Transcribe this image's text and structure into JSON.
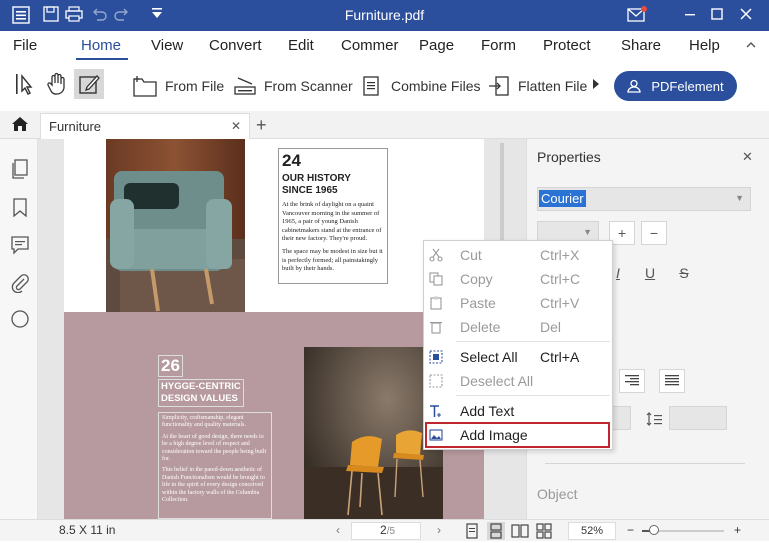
{
  "titlebar": {
    "title": "Furniture.pdf",
    "bg_color": "#2b4f9c",
    "icons": [
      "menu-icon",
      "save-icon",
      "print-icon",
      "undo-icon",
      "redo-icon",
      "quick-access-dropdown-icon",
      "mail-icon",
      "minimize-icon",
      "maximize-icon",
      "close-icon"
    ]
  },
  "menubar": {
    "items": [
      "File",
      "Home",
      "View",
      "Convert",
      "Edit",
      "Commer",
      "Page",
      "Form",
      "Protect",
      "Share",
      "Help"
    ],
    "active": "Home"
  },
  "toolbar": {
    "from_file": "From File",
    "from_scanner": "From Scanner",
    "combine_files": "Combine Files",
    "flatten_file": "Flatten File",
    "pdfelement_button": "PDFelement"
  },
  "tabs": {
    "items": [
      {
        "label": "Furniture"
      }
    ],
    "close_glyph": "✕",
    "add_glyph": "+"
  },
  "document": {
    "history": {
      "number": "24",
      "heading_line1": "OUR HISTORY",
      "heading_line2": "SINCE 1965",
      "paragraph1": "At the brink of daylight on a quaint Vancouver morning in the summer of 1965, a pair of young Danish cabinetmakers stand at the entrance of their new factory. They're proud.",
      "paragraph2": "The space may be modest in size but it is perfectly formed; all painstakingly built by their hands."
    },
    "hygge": {
      "number": "26",
      "heading_line1": "HYGGE-CENTRIC",
      "heading_line2": "DESIGN VALUES",
      "paragraph1": "Simplicity, craftsmanship, elegant functionality and quality materials.",
      "paragraph2": "At the heart of good design, there needs to be a high degree level of respect and consideration toward the people being built for.",
      "paragraph3": "This belief in the pared-down aesthetic of Danish Functionalism would be brought to life in the spirit of every design conceived within the factory walls of the Columbia Collection."
    },
    "pink_color": "#b79a9f"
  },
  "context_menu": {
    "items": [
      {
        "label": "Cut",
        "shortcut": "Ctrl+X",
        "disabled": true,
        "icon": "scissors-icon"
      },
      {
        "label": "Copy",
        "shortcut": "Ctrl+C",
        "disabled": true,
        "icon": "copy-icon"
      },
      {
        "label": "Paste",
        "shortcut": "Ctrl+V",
        "disabled": true,
        "icon": "paste-icon"
      },
      {
        "label": "Delete",
        "shortcut": "Del",
        "disabled": true,
        "icon": "trash-icon"
      },
      {
        "label": "Select All",
        "shortcut": "Ctrl+A",
        "disabled": false,
        "icon": "select-all-icon"
      },
      {
        "label": "Deselect All",
        "shortcut": "",
        "disabled": true,
        "icon": "deselect-all-icon"
      },
      {
        "label": "Add Text",
        "shortcut": "",
        "disabled": false,
        "icon": "add-text-icon"
      },
      {
        "label": "Add Image",
        "shortcut": "",
        "disabled": false,
        "icon": "add-image-icon",
        "highlighted": true
      }
    ],
    "highlight_color": "#c0262d"
  },
  "properties": {
    "title": "Properties",
    "close_glyph": "✕",
    "font_value": "Courier",
    "plus": "+",
    "minus": "−",
    "object_label": "Object"
  },
  "statusbar": {
    "page_size": "8.5 X 11 in",
    "current_page": "2",
    "total_pages": "/5",
    "zoom": "52%",
    "zoom_level": 0.15,
    "minus": "−",
    "plus": "+"
  }
}
